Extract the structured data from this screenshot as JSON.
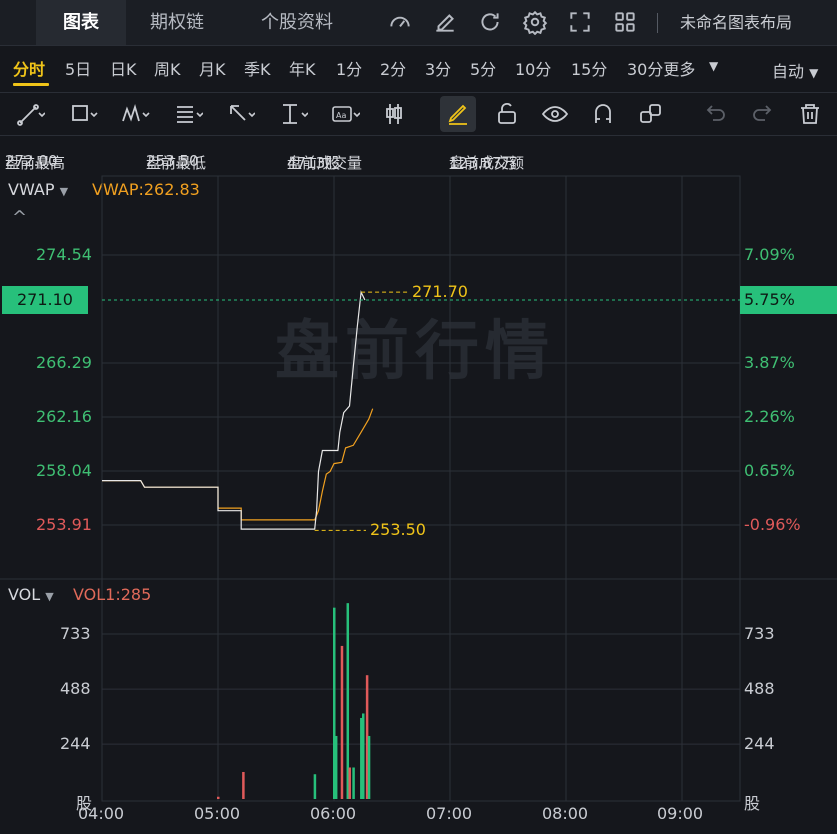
{
  "top_tabs": [
    "图表",
    "期权链",
    "个股资料"
  ],
  "layout_name": "未命名图表布局",
  "timeframes": [
    "分时",
    "5日",
    "日K",
    "周K",
    "月K",
    "季K",
    "年K",
    "1分",
    "2分",
    "3分",
    "5分",
    "10分",
    "15分",
    "30分更多"
  ],
  "auto_label": "自动",
  "premarket": {
    "high_label": "盘前最高",
    "high": "272.00",
    "low_label": "盘前最低",
    "low": "253.50",
    "vol_label": "盘前成交量",
    "vol": "4713股",
    "amt_label": "盘前成交额",
    "amt": "123.87万"
  },
  "price_panel": {
    "indicator": "VWAP",
    "indicator_value": "VWAP:262.83",
    "left_ticks": [
      "274.54",
      "266.29",
      "262.16",
      "258.04",
      "253.91"
    ],
    "right_ticks": [
      "7.09%",
      "3.87%",
      "2.26%",
      "0.65%",
      "-0.96%"
    ],
    "current_price": "271.10",
    "current_pct": "5.75%",
    "high_marker": "271.70",
    "low_marker": "253.50",
    "watermark": "盘前行情"
  },
  "vol_panel": {
    "indicator": "VOL",
    "indicator_value": "VOL1:285",
    "ticks": [
      "733",
      "488",
      "244"
    ],
    "unit": "股"
  },
  "x_ticks": [
    "04:00",
    "05:00",
    "06:00",
    "07:00",
    "08:00",
    "09:00"
  ],
  "colors": {
    "up": "#27c07b",
    "down": "#e05a5a",
    "vwap": "#f0a020",
    "price": "#e8e8e8",
    "accent": "#f0c419"
  },
  "chart_data": {
    "type": "line",
    "x_range": [
      "04:00",
      "09:30"
    ],
    "ylim": [
      252.0,
      276.0
    ],
    "series": [
      {
        "name": "VWAP",
        "points": [
          [
            "04:00",
            257.3
          ],
          [
            "04:20",
            257.3
          ],
          [
            "04:22",
            256.8
          ],
          [
            "05:00",
            256.8
          ],
          [
            "05:00",
            255.2
          ],
          [
            "05:12",
            255.2
          ],
          [
            "05:12",
            254.3
          ],
          [
            "05:50",
            254.3
          ],
          [
            "05:52",
            255.0
          ],
          [
            "05:54",
            256.5
          ],
          [
            "05:56",
            257.8
          ],
          [
            "05:58",
            258.0
          ],
          [
            "06:00",
            258.6
          ],
          [
            "06:04",
            258.7
          ],
          [
            "06:06",
            259.8
          ],
          [
            "06:10",
            260.0
          ],
          [
            "06:14",
            261.0
          ],
          [
            "06:18",
            262.0
          ],
          [
            "06:20",
            262.8
          ]
        ]
      },
      {
        "name": "价格",
        "points": [
          [
            "04:00",
            257.3
          ],
          [
            "04:20",
            257.3
          ],
          [
            "04:22",
            256.8
          ],
          [
            "05:00",
            256.8
          ],
          [
            "05:00",
            255.0
          ],
          [
            "05:12",
            255.0
          ],
          [
            "05:12",
            253.6
          ],
          [
            "05:50",
            253.6
          ],
          [
            "05:51",
            255.0
          ],
          [
            "05:52",
            258.0
          ],
          [
            "05:54",
            259.6
          ],
          [
            "06:02",
            259.6
          ],
          [
            "06:03",
            261.0
          ],
          [
            "06:05",
            262.5
          ],
          [
            "06:08",
            263.0
          ],
          [
            "06:10",
            266.0
          ],
          [
            "06:12",
            269.0
          ],
          [
            "06:14",
            271.7
          ],
          [
            "06:16",
            271.1
          ]
        ]
      }
    ],
    "volume": [
      {
        "t": "05:00",
        "v": 10,
        "dir": "down"
      },
      {
        "t": "05:13",
        "v": 120,
        "dir": "down"
      },
      {
        "t": "05:50",
        "v": 110,
        "dir": "up"
      },
      {
        "t": "06:00",
        "v": 850,
        "dir": "up"
      },
      {
        "t": "06:01",
        "v": 280,
        "dir": "up"
      },
      {
        "t": "06:04",
        "v": 680,
        "dir": "down"
      },
      {
        "t": "06:07",
        "v": 870,
        "dir": "up"
      },
      {
        "t": "06:08",
        "v": 140,
        "dir": "down"
      },
      {
        "t": "06:10",
        "v": 140,
        "dir": "up"
      },
      {
        "t": "06:14",
        "v": 360,
        "dir": "up"
      },
      {
        "t": "06:15",
        "v": 380,
        "dir": "up"
      },
      {
        "t": "06:17",
        "v": 550,
        "dir": "down"
      },
      {
        "t": "06:18",
        "v": 280,
        "dir": "up"
      }
    ],
    "vol_ylim": [
      0,
      980
    ]
  }
}
